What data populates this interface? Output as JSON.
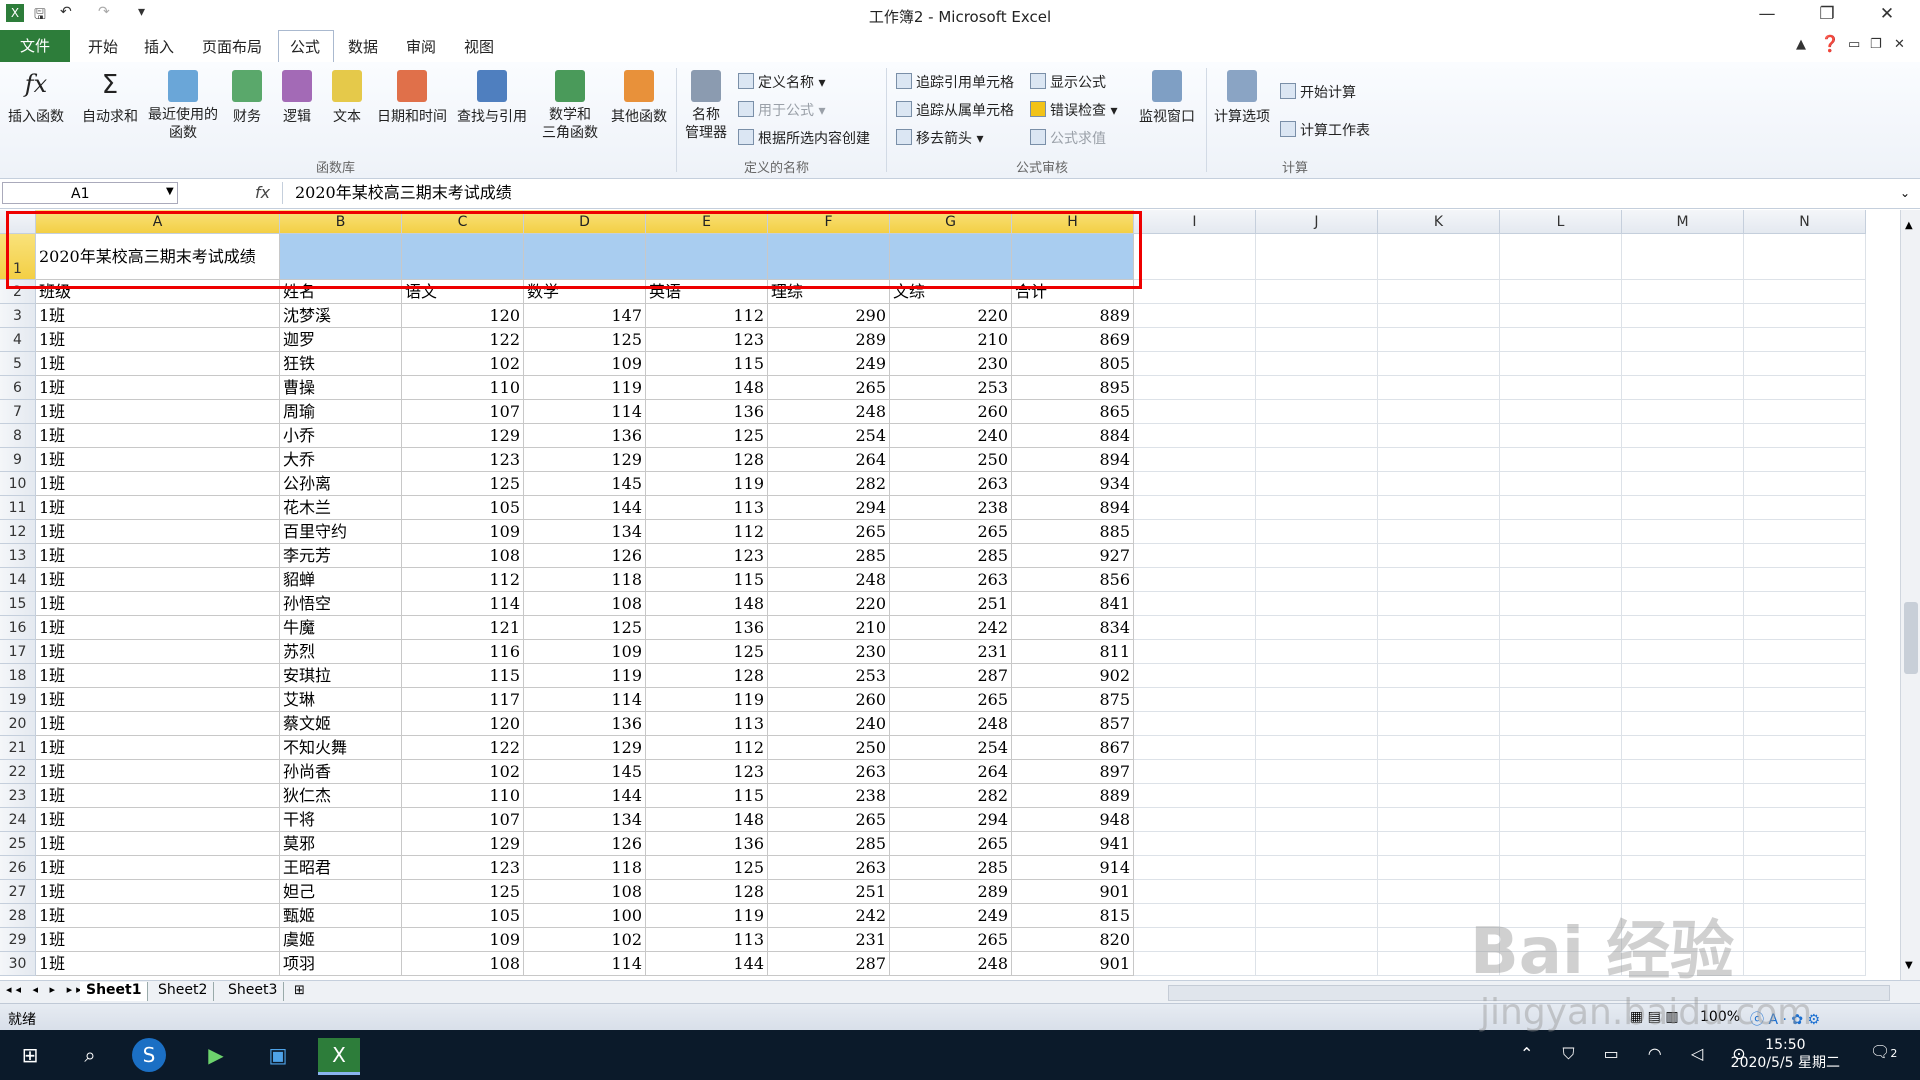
{
  "titlebar": {
    "title": "工作簿2 - Microsoft Excel",
    "undo_icon": "undo-icon",
    "redo_icon": "redo-icon",
    "save_icon": "save-icon"
  },
  "tabs": {
    "file": "文件",
    "items": [
      "开始",
      "插入",
      "页面布局",
      "公式",
      "数据",
      "审阅",
      "视图"
    ],
    "active": "公式"
  },
  "ribbon": {
    "insert_function": "插入函数",
    "autosum": "自动求和",
    "recent_line1": "最近使用的",
    "recent_line2": "函数",
    "financial": "财务",
    "logical": "逻辑",
    "text": "文本",
    "datetime": "日期和时间",
    "lookup": "查找与引用",
    "math_line1": "数学和",
    "math_line2": "三角函数",
    "other": "其他函数",
    "library_group": "函数库",
    "name_manager_line1": "名称",
    "name_manager_line2": "管理器",
    "define_name": "定义名称",
    "use_in_formula": "用于公式",
    "create_from_selection": "根据所选内容创建",
    "names_group": "定义的名称",
    "trace_precedents": "追踪引用单元格",
    "trace_dependents": "追踪从属单元格",
    "remove_arrows": "移去箭头",
    "show_formulas": "显示公式",
    "error_checking": "错误检查",
    "evaluate_formula": "公式求值",
    "watch_window": "监视窗口",
    "audit_group": "公式审核",
    "calc_options": "计算选项",
    "calc_now": "开始计算",
    "calc_sheet": "计算工作表",
    "calc_group": "计算"
  },
  "formula_bar": {
    "name_box": "A1",
    "fx": "fx",
    "content": "2020年某校高三期末考试成绩"
  },
  "columns": [
    "A",
    "B",
    "C",
    "D",
    "E",
    "F",
    "G",
    "H",
    "I",
    "J",
    "K",
    "L",
    "M",
    "N"
  ],
  "sheet": {
    "title": "2020年某校高三期末考试成绩",
    "headers": [
      "班级",
      "姓名",
      "语文",
      "数学",
      "英语",
      "理综",
      "文综",
      "合计"
    ],
    "rows": [
      [
        "1班",
        "沈梦溪",
        "120",
        "147",
        "112",
        "290",
        "220",
        "889"
      ],
      [
        "1班",
        "迦罗",
        "122",
        "125",
        "123",
        "289",
        "210",
        "869"
      ],
      [
        "1班",
        "狂铁",
        "102",
        "109",
        "115",
        "249",
        "230",
        "805"
      ],
      [
        "1班",
        "曹操",
        "110",
        "119",
        "148",
        "265",
        "253",
        "895"
      ],
      [
        "1班",
        "周瑜",
        "107",
        "114",
        "136",
        "248",
        "260",
        "865"
      ],
      [
        "1班",
        "小乔",
        "129",
        "136",
        "125",
        "254",
        "240",
        "884"
      ],
      [
        "1班",
        "大乔",
        "123",
        "129",
        "128",
        "264",
        "250",
        "894"
      ],
      [
        "1班",
        "公孙离",
        "125",
        "145",
        "119",
        "282",
        "263",
        "934"
      ],
      [
        "1班",
        "花木兰",
        "105",
        "144",
        "113",
        "294",
        "238",
        "894"
      ],
      [
        "1班",
        "百里守约",
        "109",
        "134",
        "112",
        "265",
        "265",
        "885"
      ],
      [
        "1班",
        "李元芳",
        "108",
        "126",
        "123",
        "285",
        "285",
        "927"
      ],
      [
        "1班",
        "貂蝉",
        "112",
        "118",
        "115",
        "248",
        "263",
        "856"
      ],
      [
        "1班",
        "孙悟空",
        "114",
        "108",
        "148",
        "220",
        "251",
        "841"
      ],
      [
        "1班",
        "牛魔",
        "121",
        "125",
        "136",
        "210",
        "242",
        "834"
      ],
      [
        "1班",
        "苏烈",
        "116",
        "109",
        "125",
        "230",
        "231",
        "811"
      ],
      [
        "1班",
        "安琪拉",
        "115",
        "119",
        "128",
        "253",
        "287",
        "902"
      ],
      [
        "1班",
        "艾琳",
        "117",
        "114",
        "119",
        "260",
        "265",
        "875"
      ],
      [
        "1班",
        "蔡文姬",
        "120",
        "136",
        "113",
        "240",
        "248",
        "857"
      ],
      [
        "1班",
        "不知火舞",
        "122",
        "129",
        "112",
        "250",
        "254",
        "867"
      ],
      [
        "1班",
        "孙尚香",
        "102",
        "145",
        "123",
        "263",
        "264",
        "897"
      ],
      [
        "1班",
        "狄仁杰",
        "110",
        "144",
        "115",
        "238",
        "282",
        "889"
      ],
      [
        "1班",
        "干将",
        "107",
        "134",
        "148",
        "265",
        "294",
        "948"
      ],
      [
        "1班",
        "莫邪",
        "129",
        "126",
        "136",
        "285",
        "265",
        "941"
      ],
      [
        "1班",
        "王昭君",
        "123",
        "118",
        "125",
        "263",
        "285",
        "914"
      ],
      [
        "1班",
        "妲己",
        "125",
        "108",
        "128",
        "251",
        "289",
        "901"
      ],
      [
        "1班",
        "甄姬",
        "105",
        "100",
        "119",
        "242",
        "249",
        "815"
      ],
      [
        "1班",
        "虞姬",
        "109",
        "102",
        "113",
        "231",
        "265",
        "820"
      ],
      [
        "1班",
        "项羽",
        "108",
        "114",
        "144",
        "287",
        "248",
        "901"
      ]
    ]
  },
  "sheet_tabs": [
    "Sheet1",
    "Sheet2",
    "Sheet3"
  ],
  "status": {
    "ready": "就绪",
    "zoom": "100%"
  },
  "taskbar": {
    "time": "15:50",
    "date": "2020/5/5 星期二",
    "notifications": "2"
  },
  "watermark": {
    "brand": "Bai 经验",
    "url": "jingyan.baidu.com"
  },
  "colors": {
    "file_tab": "#2d7d3a",
    "selection_fill": "#a9cdf0",
    "selection_border": "#e00000",
    "header_selected": "#f3cf45"
  }
}
